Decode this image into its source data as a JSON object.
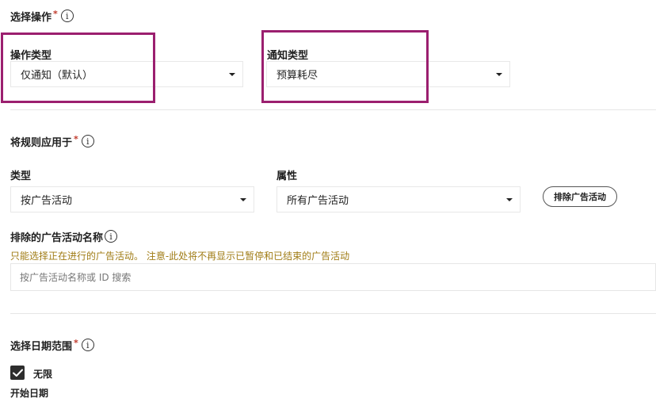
{
  "select_operation": {
    "title": "选择操作",
    "required_mark": "*",
    "info_icon_glyph": "i",
    "operation_type": {
      "label": "操作类型",
      "value": "仅通知（默认）"
    },
    "notification_type": {
      "label": "通知类型",
      "value": "预算耗尽"
    }
  },
  "apply_rule": {
    "title": "将规则应用于",
    "required_mark": "*",
    "info_icon_glyph": "i",
    "type": {
      "label": "类型",
      "value": "按广告活动"
    },
    "attribute": {
      "label": "属性",
      "value": "所有广告活动"
    },
    "exclude_button_label": "排除广告活动",
    "excluded_names": {
      "label": "排除的广告活动名称",
      "info_icon_glyph": "i",
      "warning": "只能选择正在进行的广告活动。 注意-此处将不再显示已暂停和已结束的广告活动",
      "search_placeholder": "按广告活动名称或 ID 搜索"
    }
  },
  "date_range": {
    "title": "选择日期范围",
    "required_mark": "*",
    "info_icon_glyph": "i",
    "unlimited_label": "无限",
    "unlimited_checked": true,
    "start_date_label": "开始日期"
  },
  "colors": {
    "highlight_border": "#9b1f6f",
    "warning_text": "#a07c15",
    "required_star": "#c0392b",
    "checkbox_fill": "#2d2d2d"
  },
  "icons": {
    "info": "info-circle-icon",
    "dropdown": "caret-down-icon",
    "check": "checkmark-icon"
  }
}
